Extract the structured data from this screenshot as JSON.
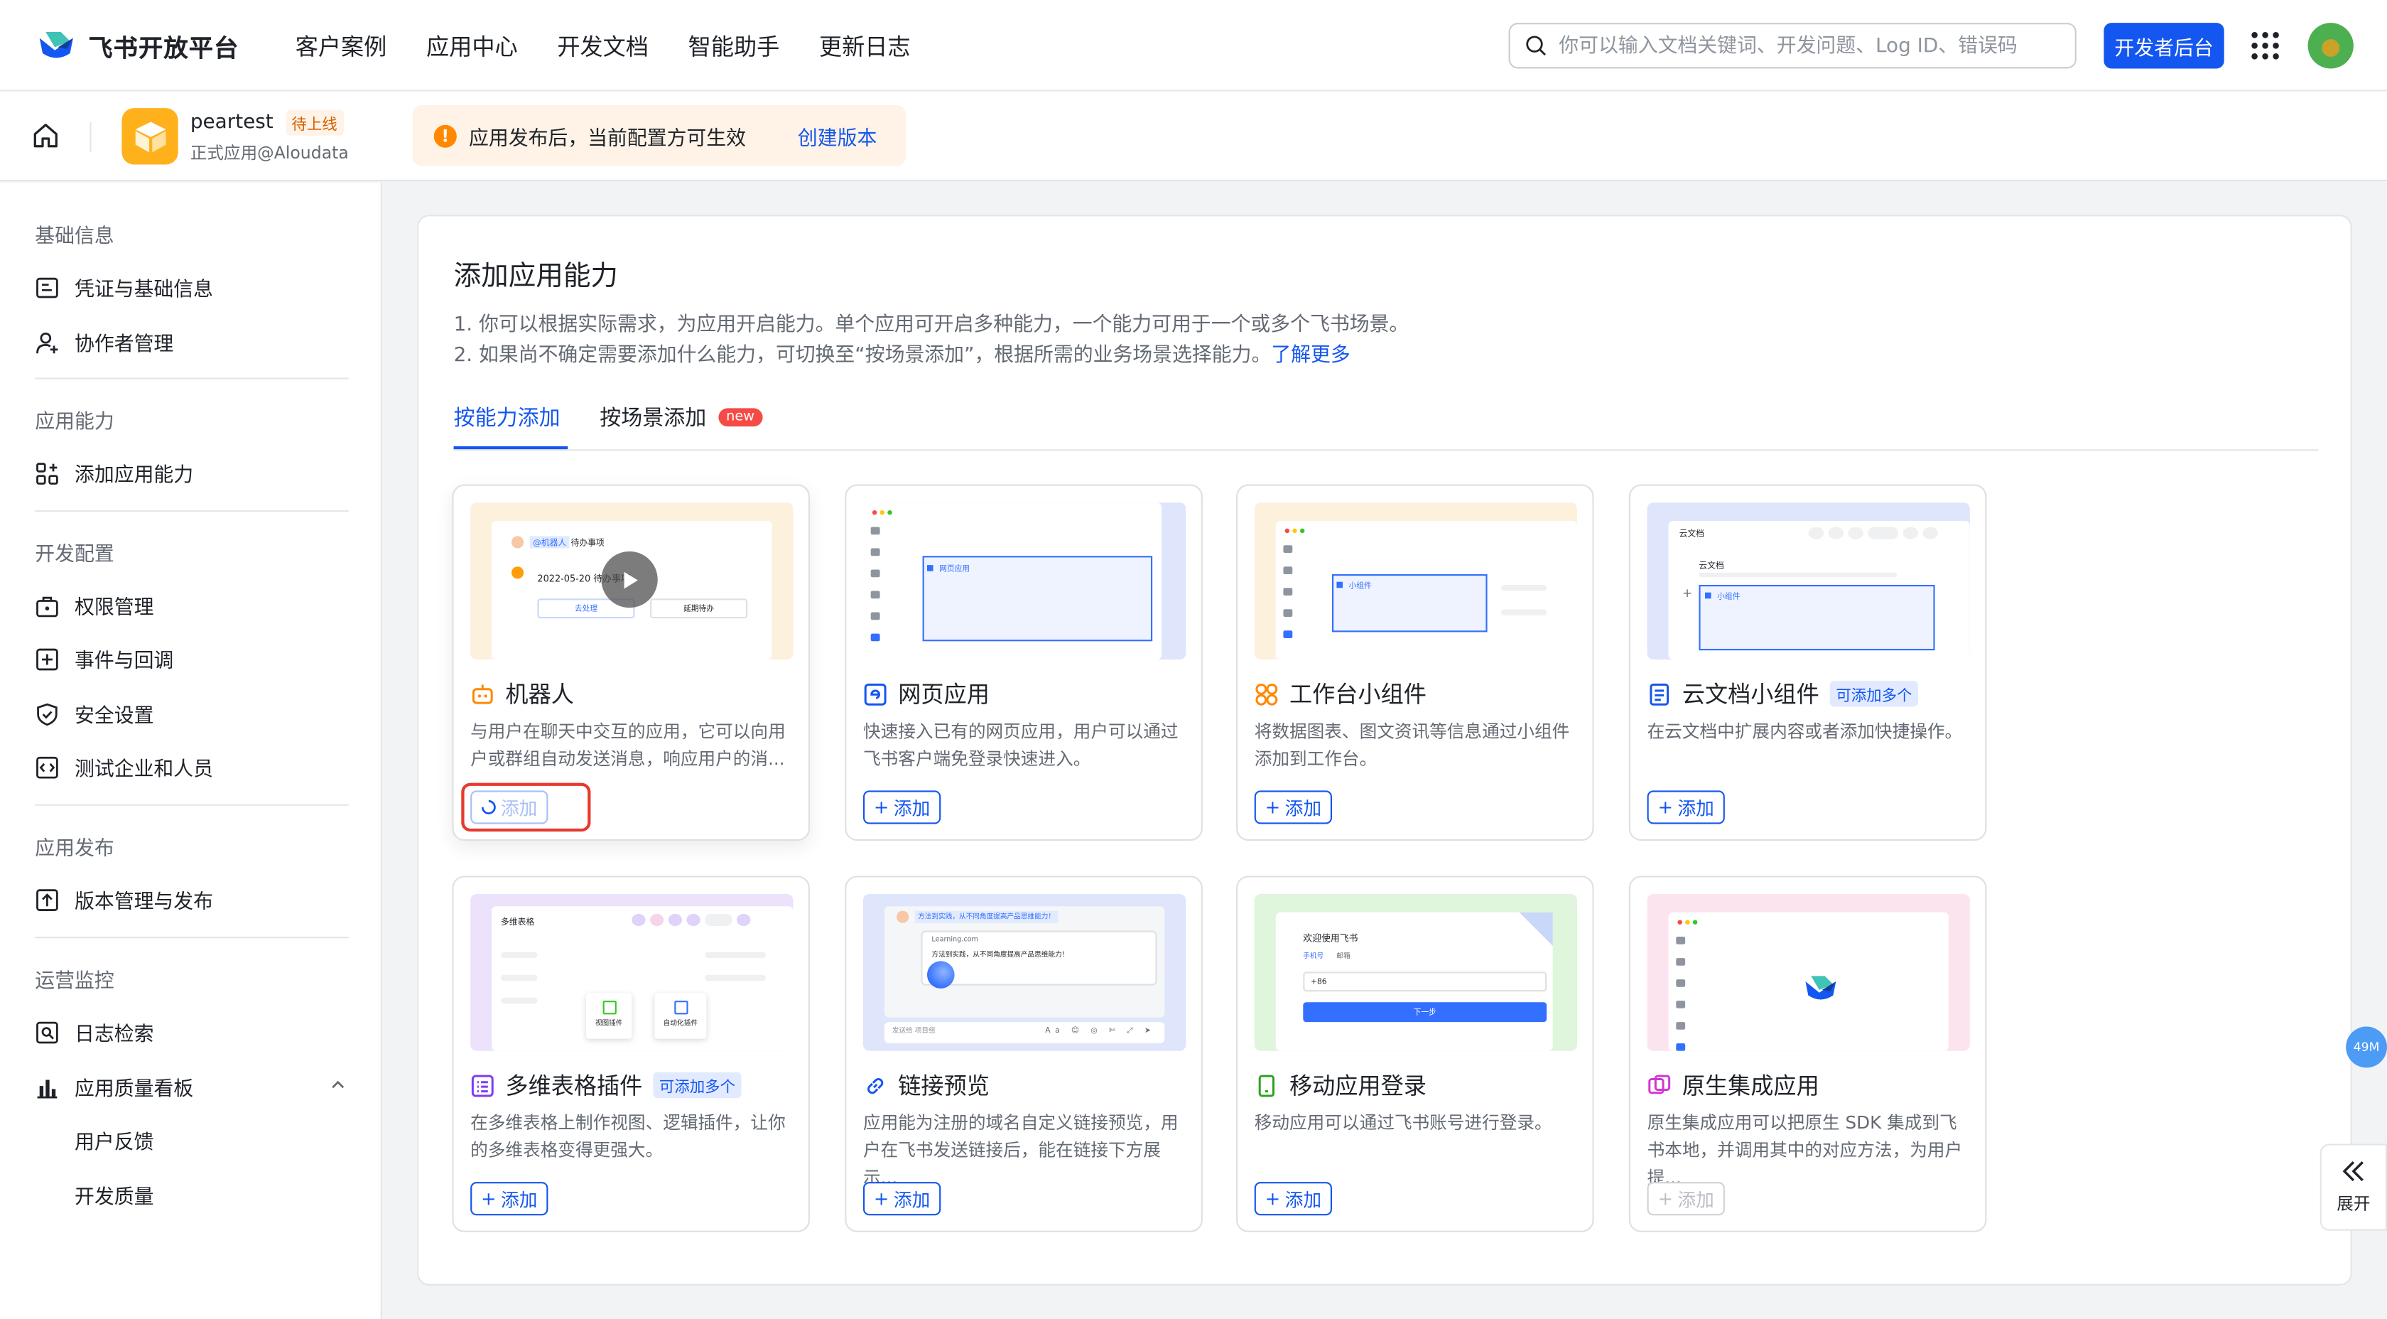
{
  "topnav": {
    "brand": "飞书开放平台",
    "items": [
      "客户案例",
      "应用中心",
      "开发文档",
      "智能助手",
      "更新日志"
    ],
    "search_placeholder": "你可以输入文档关键词、开发问题、Log ID、错误码",
    "dev_button": "开发者后台",
    "brand_color": "#1456f0"
  },
  "subhead": {
    "app_name": "peartest",
    "app_status": "待上线",
    "app_sub": "正式应用@Aloudata",
    "notice_text": "应用发布后，当前配置方可生效",
    "notice_link": "创建版本"
  },
  "sidebar": {
    "sections": [
      {
        "title": "基础信息",
        "items": [
          "凭证与基础信息",
          "协作者管理"
        ]
      },
      {
        "title": "应用能力",
        "items": [
          "添加应用能力"
        ]
      },
      {
        "title": "开发配置",
        "items": [
          "权限管理",
          "事件与回调",
          "安全设置",
          "测试企业和人员"
        ]
      },
      {
        "title": "应用发布",
        "items": [
          "版本管理与发布"
        ]
      },
      {
        "title": "运营监控",
        "items": [
          "日志检索",
          "应用质量看板"
        ],
        "subitems": [
          "用户反馈",
          "开发质量"
        ]
      }
    ]
  },
  "main": {
    "title": "添加应用能力",
    "desc1": "1. 你可以根据实际需求，为应用开启能力。单个应用可开启多种能力，一个能力可用于一个或多个飞书场景。",
    "desc2": "2. 如果尚不确定需要添加什么能力，可切换至“按场景添加”，根据所需的业务场景选择能力。",
    "desc2_link": "了解更多",
    "tabs": [
      "按能力添加",
      "按场景添加"
    ],
    "new_badge": "new",
    "add_label": "添加",
    "multi_tag": "可添加多个"
  },
  "cards": [
    {
      "title": "机器人",
      "desc": "与用户在聊天中交互的应用，它可以向用户或群组自动发送消息，响应用户的消...",
      "state": "loading",
      "icon": "robot-icon"
    },
    {
      "title": "网页应用",
      "desc": "快速接入已有的网页应用，用户可以通过飞书客户端免登录快速进入。",
      "state": "normal",
      "icon": "web-app-icon"
    },
    {
      "title": "工作台小组件",
      "desc": "将数据图表、图文资讯等信息通过小组件添加到工作台。",
      "state": "normal",
      "icon": "widget-grid-icon"
    },
    {
      "title": "云文档小组件",
      "desc": "在云文档中扩展内容或者添加快捷操作。",
      "state": "normal",
      "icon": "doc-icon",
      "multi": true
    },
    {
      "title": "多维表格插件",
      "desc": "在多维表格上制作视图、逻辑插件，让你的多维表格变得更强大。",
      "state": "normal",
      "icon": "base-table-icon",
      "multi": true
    },
    {
      "title": "链接预览",
      "desc": "应用能为注册的域名自定义链接预览，用户在飞书发送链接后，能在链接下方展示...",
      "state": "normal",
      "icon": "link-icon"
    },
    {
      "title": "移动应用登录",
      "desc": "移动应用可以通过飞书账号进行登录。",
      "state": "normal",
      "icon": "mobile-icon"
    },
    {
      "title": "原生集成应用",
      "desc": "原生集成应用可以把原生 SDK 集成到飞书本地，并调用其中的对应方法，为用户提...",
      "state": "disabled",
      "icon": "native-app-icon"
    }
  ],
  "thumbs": {
    "robot": {
      "chip": "@机器人",
      "task": "待办事项",
      "date": "2022-05-20 待办事项",
      "btn1": "去处理",
      "btn2": "延期待办"
    },
    "web": {
      "label": "网页应用"
    },
    "widget": {
      "label": "小组件"
    },
    "doc": {
      "title": "云文档",
      "sub": "云文档",
      "label": "小组件"
    },
    "base": {
      "title": "多维表格",
      "p1": "视图插件",
      "p2": "自动化插件"
    },
    "link": {
      "chip": "方法到实践，从不同角度提高产品思维能力！",
      "url": "Learning.com",
      "body": "方法到实践，从不同角度提高产品思维能力！",
      "input": "发送给 项目组"
    },
    "mobile": {
      "title": "欢迎使用飞书",
      "tab1": "手机号",
      "tab2": "邮箱",
      "code": "+86",
      "btn": "下一步"
    }
  },
  "widgets": {
    "mem": "49M",
    "expand": "展开"
  }
}
